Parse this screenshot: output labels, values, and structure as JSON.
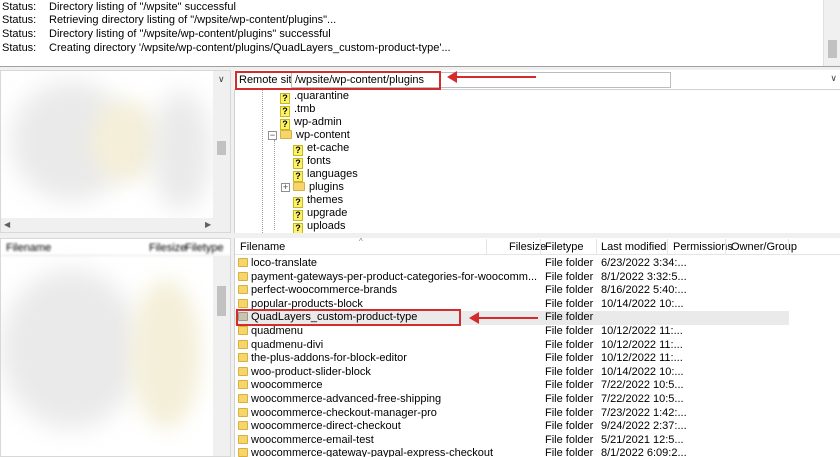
{
  "log": [
    {
      "label": "Status:",
      "message": "Directory listing of \"/wpsite\" successful"
    },
    {
      "label": "Status:",
      "message": "Retrieving directory listing of \"/wpsite/wp-content/plugins\"..."
    },
    {
      "label": "Status:",
      "message": "Directory listing of \"/wpsite/wp-content/plugins\" successful"
    },
    {
      "label": "Status:",
      "message": "Creating directory '/wpsite/wp-content/plugins/QuadLayers_custom-product-type'..."
    }
  ],
  "remote": {
    "label": "Remote site:",
    "path": "/wpsite/wp-content/plugins"
  },
  "tree": [
    {
      "name": ".quarantine",
      "icon": "question-folder-icon"
    },
    {
      "name": ".tmb",
      "icon": "question-folder-icon"
    },
    {
      "name": "wp-admin",
      "icon": "question-folder-icon"
    },
    {
      "name": "wp-content",
      "icon": "folder-icon"
    },
    {
      "name": "et-cache",
      "icon": "question-folder-icon"
    },
    {
      "name": "fonts",
      "icon": "question-folder-icon"
    },
    {
      "name": "languages",
      "icon": "question-folder-icon"
    },
    {
      "name": "plugins",
      "icon": "folder-icon"
    },
    {
      "name": "themes",
      "icon": "question-folder-icon"
    },
    {
      "name": "upgrade",
      "icon": "question-folder-icon"
    },
    {
      "name": "uploads",
      "icon": "question-folder-icon"
    }
  ],
  "local_columns": {
    "filename": "Filename",
    "filesize": "Filesize",
    "filetype": "Filetype"
  },
  "columns": {
    "filename": "Filename",
    "filesize": "Filesize",
    "filetype": "Filetype",
    "last_modified": "Last modified",
    "permissions": "Permissions",
    "owner_group": "Owner/Group"
  },
  "files": [
    {
      "name": "loco-translate",
      "type": "File folder",
      "modified": "6/23/2022 3:34:..."
    },
    {
      "name": "payment-gateways-per-product-categories-for-woocomm...",
      "type": "File folder",
      "modified": "8/1/2022 3:32:5..."
    },
    {
      "name": "perfect-woocommerce-brands",
      "type": "File folder",
      "modified": "8/16/2022 5:40:..."
    },
    {
      "name": "popular-products-block",
      "type": "File folder",
      "modified": "10/14/2022 10:..."
    },
    {
      "name": "QuadLayers_custom-product-type",
      "type": "File folder",
      "modified": ""
    },
    {
      "name": "quadmenu",
      "type": "File folder",
      "modified": "10/12/2022 11:..."
    },
    {
      "name": "quadmenu-divi",
      "type": "File folder",
      "modified": "10/12/2022 11:..."
    },
    {
      "name": "the-plus-addons-for-block-editor",
      "type": "File folder",
      "modified": "10/12/2022 11:..."
    },
    {
      "name": "woo-product-slider-block",
      "type": "File folder",
      "modified": "10/14/2022 10:..."
    },
    {
      "name": "woocommerce",
      "type": "File folder",
      "modified": "7/22/2022 10:5..."
    },
    {
      "name": "woocommerce-advanced-free-shipping",
      "type": "File folder",
      "modified": "7/22/2022 10:5..."
    },
    {
      "name": "woocommerce-checkout-manager-pro",
      "type": "File folder",
      "modified": "7/23/2022 1:42:..."
    },
    {
      "name": "woocommerce-direct-checkout",
      "type": "File folder",
      "modified": "9/24/2022 2:37:..."
    },
    {
      "name": "woocommerce-email-test",
      "type": "File folder",
      "modified": "5/21/2021 12:5..."
    },
    {
      "name": "woocommerce-gateway-paypal-express-checkout",
      "type": "File folder",
      "modified": "8/1/2022 6:09:2..."
    }
  ],
  "colors": {
    "annotation": "#d42c2c",
    "folder": "#f6d56b",
    "selected_row": "#eaeaea"
  }
}
